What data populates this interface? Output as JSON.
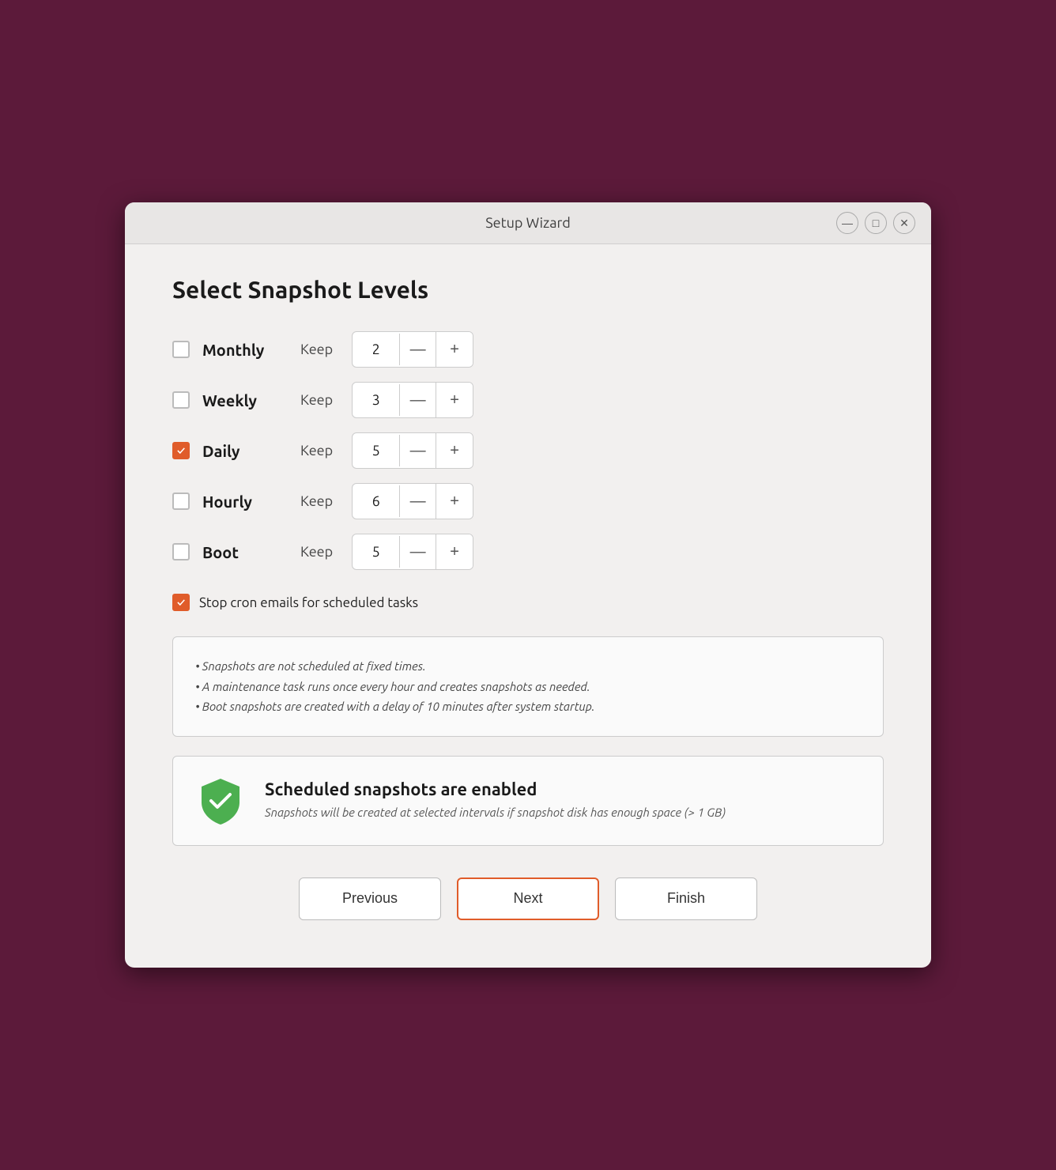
{
  "window": {
    "title": "Setup Wizard"
  },
  "controls": {
    "minimize": "—",
    "maximize": "□",
    "close": "✕"
  },
  "page": {
    "title": "Select Snapshot Levels"
  },
  "snapshot_rows": [
    {
      "id": "monthly",
      "label": "Monthly",
      "checked": false,
      "keep_label": "Keep",
      "value": 2
    },
    {
      "id": "weekly",
      "label": "Weekly",
      "checked": false,
      "keep_label": "Keep",
      "value": 3
    },
    {
      "id": "daily",
      "label": "Daily",
      "checked": true,
      "keep_label": "Keep",
      "value": 5
    },
    {
      "id": "hourly",
      "label": "Hourly",
      "checked": false,
      "keep_label": "Keep",
      "value": 6
    },
    {
      "id": "boot",
      "label": "Boot",
      "checked": false,
      "keep_label": "Keep",
      "value": 5
    }
  ],
  "cron": {
    "checked": true,
    "label": "Stop cron emails for scheduled tasks"
  },
  "info_bullets": [
    "• Snapshots are not scheduled at fixed times.",
    "• A maintenance task runs once every hour and creates snapshots as needed.",
    "• Boot snapshots are created with a delay of 10 minutes after system startup."
  ],
  "status": {
    "title": "Scheduled snapshots are enabled",
    "description": "Snapshots will be created at selected intervals if snapshot disk has enough space (> 1 GB)"
  },
  "buttons": {
    "previous": "Previous",
    "next": "Next",
    "finish": "Finish"
  }
}
